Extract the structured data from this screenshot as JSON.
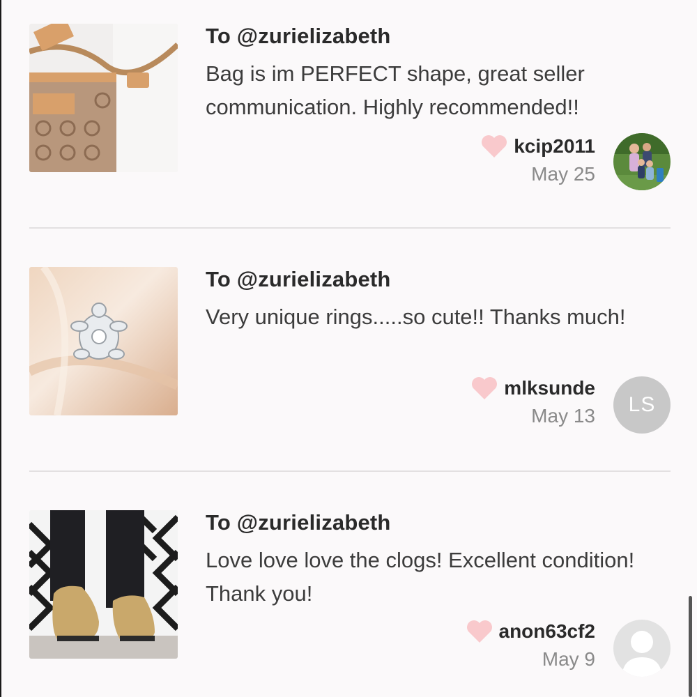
{
  "reviews": [
    {
      "to_label": "To @zurielizabeth",
      "message": "Bag is im PERFECT shape, great seller communication. Highly recommended!!",
      "username": "kcip2011",
      "date": "May 25",
      "avatar_type": "photo",
      "thumbnail": "coach-bag-photo"
    },
    {
      "to_label": "To @zurielizabeth",
      "message": "Very unique rings.....so cute!! Thanks much!",
      "username": "mlksunde",
      "date": "May 13",
      "avatar_type": "initials",
      "avatar_initials": "LS",
      "thumbnail": "turtle-ring-photo"
    },
    {
      "to_label": "To @zurielizabeth",
      "message": "Love love love the clogs! Excellent condition! Thank you!",
      "username": "anon63cf2",
      "date": "May 9",
      "avatar_type": "placeholder",
      "thumbnail": "clogs-photo"
    }
  ],
  "colors": {
    "heart": "#f9c9cc",
    "background": "#fbf9fa",
    "divider": "#e3e0e1"
  },
  "icons": {
    "like": "heart-icon",
    "default_avatar": "person-silhouette-icon"
  }
}
